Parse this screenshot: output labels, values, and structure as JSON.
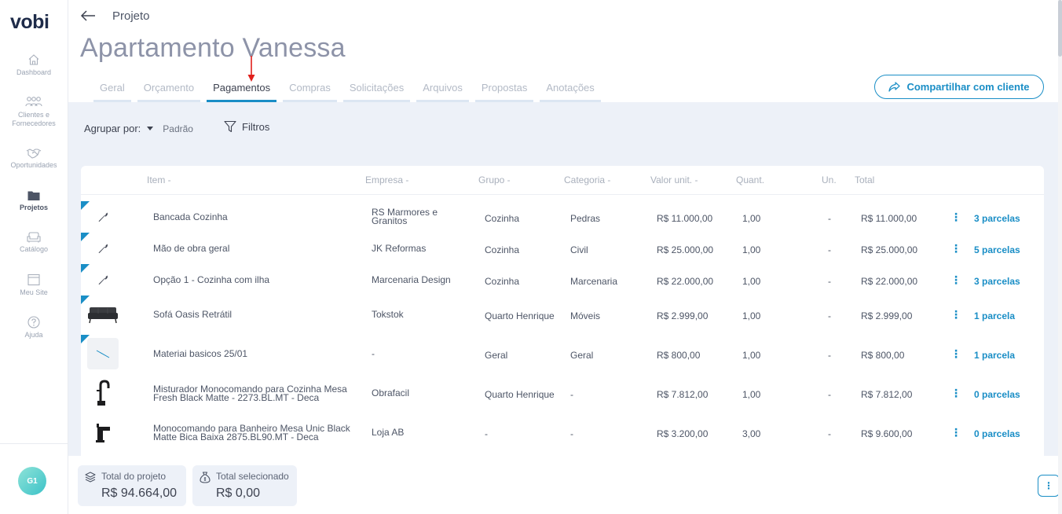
{
  "app": {
    "logo": "vobi"
  },
  "sidebar": {
    "items": [
      {
        "label": "Dashboard",
        "icon": "home-icon"
      },
      {
        "label": "Clientes e Fornecedores",
        "icon": "users-icon"
      },
      {
        "label": "Oportunidades",
        "icon": "handshake-icon"
      },
      {
        "label": "Projetos",
        "icon": "folder-icon",
        "active": true
      },
      {
        "label": "Catálogo",
        "icon": "sofa-icon"
      },
      {
        "label": "Meu Site",
        "icon": "browser-icon"
      },
      {
        "label": "Ajuda",
        "icon": "help-icon"
      }
    ],
    "avatar_initials": "G1"
  },
  "header": {
    "breadcrumb": "Projeto",
    "title": "Apartamento Vanessa",
    "share_label": "Compartilhar com cliente"
  },
  "tabs": [
    {
      "label": "Geral"
    },
    {
      "label": "Orçamento"
    },
    {
      "label": "Pagamentos",
      "active": true
    },
    {
      "label": "Compras"
    },
    {
      "label": "Solicitações"
    },
    {
      "label": "Arquivos"
    },
    {
      "label": "Propostas"
    },
    {
      "label": "Anotações"
    }
  ],
  "toolbar": {
    "group_label": "Agrupar por:",
    "group_value": "Padrão",
    "filters_label": "Filtros"
  },
  "table": {
    "headers": {
      "item": "Item -",
      "company": "Empresa -",
      "group": "Grupo -",
      "category": "Categoria -",
      "unit_value": "Valor unit. -",
      "quantity": "Quant.",
      "unit": "Un.",
      "total": "Total"
    },
    "rows": [
      {
        "thumb": "wrench-icon",
        "item": "Bancada Cozinha",
        "company": "RS Marmores e Granitos",
        "group": "Cozinha",
        "category": "Pedras",
        "unit_value": "R$ 11.000,00",
        "quantity": "1,00",
        "unit": "-",
        "total": "R$ 11.000,00",
        "parcelas": "3 parcelas"
      },
      {
        "thumb": "wrench-icon",
        "item": "Mão de obra geral",
        "company": "JK Reformas",
        "group": "Cozinha",
        "category": "Civil",
        "unit_value": "R$ 25.000,00",
        "quantity": "1,00",
        "unit": "-",
        "total": "R$ 25.000,00",
        "parcelas": "5 parcelas"
      },
      {
        "thumb": "wrench-icon",
        "item": "Opção 1 - Cozinha com ilha",
        "company": "Marcenaria Design",
        "group": "Cozinha",
        "category": "Marcenaria",
        "unit_value": "R$ 22.000,00",
        "quantity": "1,00",
        "unit": "-",
        "total": "R$ 22.000,00",
        "parcelas": "3 parcelas"
      },
      {
        "thumb": "sofa-image",
        "item": "Sofá Oasis Retrátil",
        "company": "Tokstok",
        "group": "Quarto Henrique",
        "category": "Móveis",
        "unit_value": "R$ 2.999,00",
        "quantity": "1,00",
        "unit": "-",
        "total": "R$ 2.999,00",
        "parcelas": "1 parcela"
      },
      {
        "thumb": "placeholder-image",
        "item": "Materiai basicos 25/01",
        "company": "-",
        "group": "Geral",
        "category": "Geral",
        "unit_value": "R$ 800,00",
        "quantity": "1,00",
        "unit": "-",
        "total": "R$ 800,00",
        "parcelas": "1 parcela"
      },
      {
        "thumb": "faucet-image",
        "item": "Misturador Monocomando para Cozinha Mesa Fresh Black Matte - 2273.BL.MT - Deca",
        "company": "Obrafacil",
        "group": "Quarto Henrique",
        "category": "-",
        "unit_value": "R$ 7.812,00",
        "quantity": "1,00",
        "unit": "-",
        "total": "R$ 7.812,00",
        "parcelas": "0 parcelas"
      },
      {
        "thumb": "basin-faucet-image",
        "item": "Monocomando para Banheiro Mesa Unic Black Matte Bica Baixa 2875.BL90.MT - Deca",
        "company": "Loja AB",
        "group": "-",
        "category": "-",
        "unit_value": "R$ 3.200,00",
        "quantity": "3,00",
        "unit": "-",
        "total": "R$ 9.600,00",
        "parcelas": "0 parcelas"
      }
    ]
  },
  "footer": {
    "project_total_label": "Total do projeto",
    "project_total_value": "R$ 94.664,00",
    "selected_total_label": "Total selecionado",
    "selected_total_value": "R$ 0,00",
    "more_label": "⋮"
  },
  "colors": {
    "accent": "#1a8ec6",
    "content_bg": "#edf1f8",
    "title": "#8d93a8"
  }
}
